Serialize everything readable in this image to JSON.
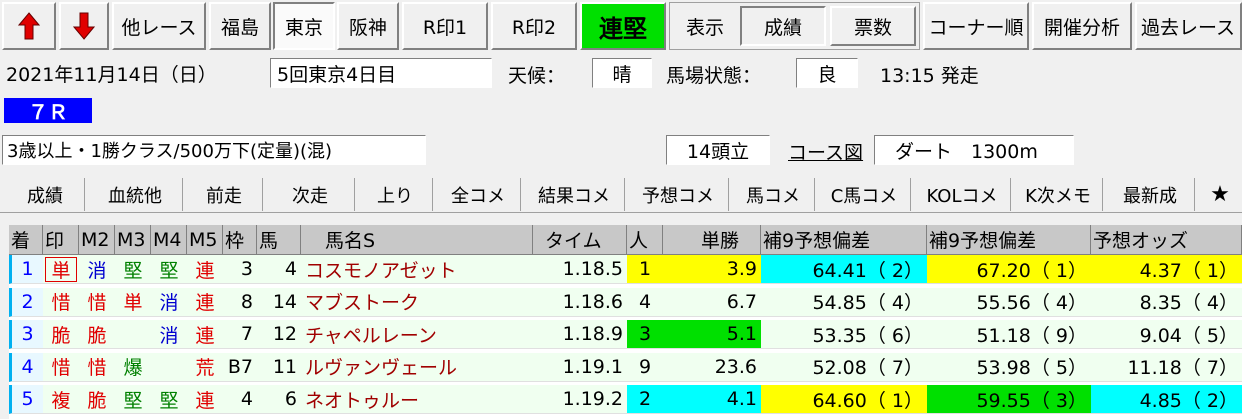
{
  "toolbar": {
    "up_arrow_label": "↑",
    "down_arrow_label": "↓",
    "other_race": "他レース",
    "venues": [
      "福島",
      "東京",
      "阪神"
    ],
    "r_mark1": "R印1",
    "r_mark2": "R印2",
    "bet_type": "連堅",
    "display_label": "表示",
    "view_results": "成績",
    "view_votes": "票数",
    "corner_order": "コーナー順",
    "meeting_analysis": "開催分析",
    "past_races": "過去レース"
  },
  "race_info": {
    "date": "2021年11月14日（日）",
    "meeting": "5回東京4日目",
    "weather_label": "天候：",
    "weather": "晴",
    "track_label": "馬場状態：",
    "track": "良",
    "start_time": "13:15 発走",
    "race_number": "７Ｒ",
    "conditions": "3歳以上・1勝クラス/500万下(定量)(混)",
    "runners": "14頭立",
    "course_map_link": "コース図",
    "course": "ダート　1300m"
  },
  "tabs": [
    "成績",
    "血統他",
    "前走",
    "次走",
    "上り",
    "全コメ",
    "結果コメ",
    "予想コメ",
    "馬コメ",
    "C馬コメ",
    "KOLコメ",
    "K次メモ",
    "最新成",
    "★"
  ],
  "table": {
    "headers": [
      "着",
      "印",
      "M2",
      "M3",
      "M4",
      "M5",
      "枠",
      "馬",
      "馬名S",
      "タイム",
      "人",
      "単勝",
      "補9予想偏差",
      "補9予想偏差",
      "予想オッズ"
    ],
    "rows": [
      {
        "rank": "1",
        "mark": "単",
        "m2": "消",
        "m3": "堅",
        "m4": "堅",
        "m5": "連",
        "waku": "3",
        "num": "4",
        "name": "コスモノアゼット",
        "time": "1.18.5",
        "pop": "1",
        "odds": "3.9",
        "dev1": "64.41（ 2）",
        "dev2": "67.20（ 1）",
        "pred": "4.37（ 1）"
      },
      {
        "rank": "2",
        "mark": "惜",
        "m2": "惜",
        "m3": "単",
        "m4": "消",
        "m5": "連",
        "waku": "8",
        "num": "14",
        "name": "マブストーク",
        "time": "1.18.6",
        "pop": "4",
        "odds": "6.7",
        "dev1": "54.85（ 4）",
        "dev2": "55.56（ 4）",
        "pred": "8.35（ 4）"
      },
      {
        "rank": "3",
        "mark": "脆",
        "m2": "脆",
        "m3": "",
        "m4": "消",
        "m5": "連",
        "waku": "7",
        "num": "12",
        "name": "チャペルレーン",
        "time": "1.18.9",
        "pop": "3",
        "odds": "5.1",
        "dev1": "53.35（ 6）",
        "dev2": "51.18（ 9）",
        "pred": "9.04（ 5）"
      },
      {
        "rank": "4",
        "mark": "惜",
        "m2": "惜",
        "m3": "爆",
        "m4": "",
        "m5": "荒",
        "waku": "B7",
        "num": "11",
        "name": "ルヴァンヴェール",
        "time": "1.19.1",
        "pop": "9",
        "odds": "23.6",
        "dev1": "52.08（ 7）",
        "dev2": "53.98（ 5）",
        "pred": "11.18（ 7）"
      },
      {
        "rank": "5",
        "mark": "複",
        "m2": "脆",
        "m3": "堅",
        "m4": "堅",
        "m5": "連",
        "waku": "4",
        "num": "6",
        "name": "ネオトゥルー",
        "time": "1.19.2",
        "pop": "2",
        "odds": "4.1",
        "dev1": "64.60（ 1）",
        "dev2": "59.55（ 3）",
        "pred": "4.85（ 2）"
      }
    ]
  },
  "colors": {
    "mark_red": "#e00000",
    "mark_blue": "#0000d0",
    "mark_green": "#008000",
    "name_red": "#a00000",
    "hl_yellow": "#ffff00",
    "hl_cyan": "#00ffff",
    "hl_green": "#00e000",
    "rank_cyan": "#00b0f0",
    "race_blue": "#0000ff"
  }
}
